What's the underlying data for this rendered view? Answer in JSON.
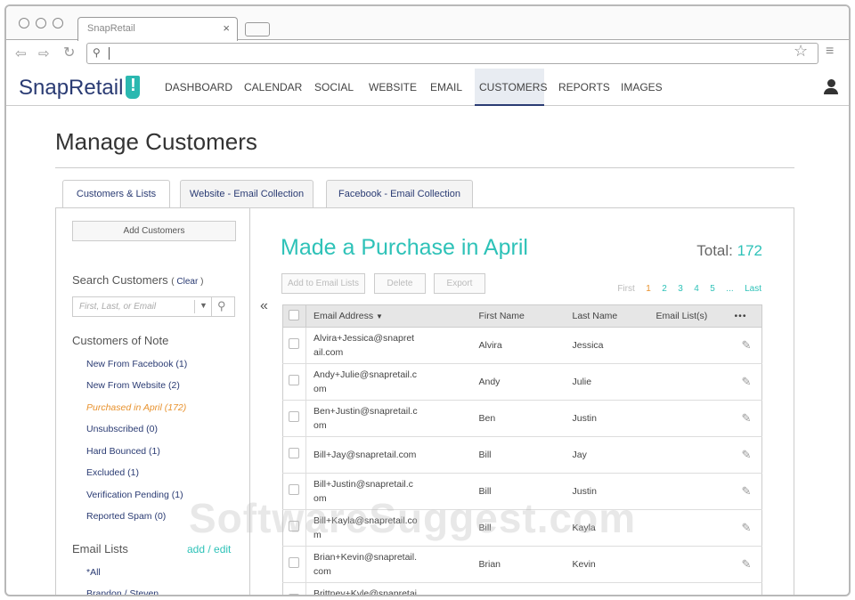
{
  "browser": {
    "tab_title": "SnapRetail",
    "close": "×"
  },
  "nav": {
    "logo": "SnapRetail",
    "logo_mark": "!",
    "items": [
      "DASHBOARD",
      "CALENDAR",
      "SOCIAL",
      "WEBSITE",
      "EMAIL",
      "CUSTOMERS",
      "REPORTS",
      "IMAGES"
    ],
    "active": "CUSTOMERS"
  },
  "page": {
    "title": "Manage Customers",
    "tabs": [
      "Customers & Lists",
      "Website - Email Collection",
      "Facebook - Email Collection"
    ]
  },
  "sidebar": {
    "add_button": "Add Customers",
    "search_label": "Search Customers",
    "clear_open": "( ",
    "clear": "Clear",
    "clear_close": " )",
    "search_placeholder": "First, Last, or Email",
    "notes_title": "Customers of Note",
    "notes": [
      "New From Facebook (1)",
      "New From Website (2)",
      "Purchased in April (172)",
      "Unsubscribed (0)",
      "Hard Bounced (1)",
      "Excluded (1)",
      "Verification Pending (1)",
      "Reported Spam (0)"
    ],
    "lists_title": "Email Lists",
    "lists_action": "add / edit",
    "lists": [
      "*All",
      "Brandon / Steven"
    ]
  },
  "main": {
    "title": "Made a Purchase in April",
    "total_label": "Total:",
    "total": "172",
    "actions": [
      "Add to Email Lists",
      "Delete",
      "Export"
    ],
    "pagination": {
      "first": "First",
      "pages": [
        "1",
        "2",
        "3",
        "4",
        "5"
      ],
      "ellipsis": "...",
      "last": "Last",
      "current": "1"
    },
    "columns": [
      "Email Address",
      "First Name",
      "Last Name",
      "Email List(s)",
      "•••"
    ],
    "rows": [
      {
        "email": "Alvira+Jessica@snapretail.com",
        "first": "Alvira",
        "last": "Jessica",
        "lists": ""
      },
      {
        "email": "Andy+Julie@snapretail.com",
        "first": "Andy",
        "last": "Julie",
        "lists": ""
      },
      {
        "email": "Ben+Justin@snapretail.com",
        "first": "Ben",
        "last": "Justin",
        "lists": ""
      },
      {
        "email": "Bill+Jay@snapretail.com",
        "first": "Bill",
        "last": "Jay",
        "lists": ""
      },
      {
        "email": "Bill+Justin@snapretail.com",
        "first": "Bill",
        "last": "Justin",
        "lists": ""
      },
      {
        "email": "Bill+Kayla@snapretail.com",
        "first": "Bill",
        "last": "Kayla",
        "lists": ""
      },
      {
        "email": "Brian+Kevin@snapretail.com",
        "first": "Brian",
        "last": "Kevin",
        "lists": ""
      },
      {
        "email": "Brittney+Kyle@snapretail.com",
        "first": "",
        "last": "",
        "lists": ""
      }
    ]
  },
  "watermark": "SoftwareSuggest.com",
  "colors": {
    "teal": "#2ec2b8",
    "navy": "#2a3b73",
    "orange": "#e8922e"
  }
}
